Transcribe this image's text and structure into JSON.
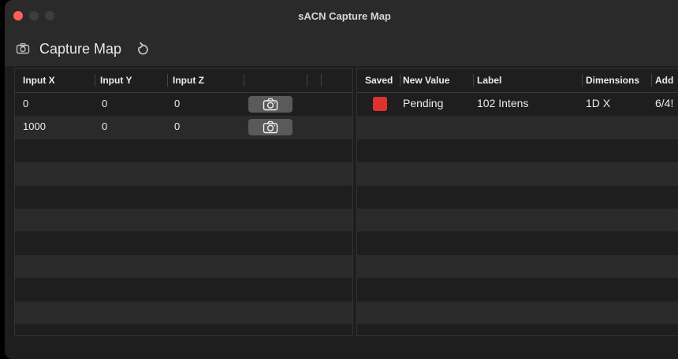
{
  "window": {
    "title": "sACN Capture Map"
  },
  "toolbar": {
    "title": "Capture Map"
  },
  "left_table": {
    "headers": [
      "Input X",
      "Input Y",
      "Input Z"
    ],
    "rows": [
      {
        "x": "0",
        "y": "0",
        "z": "0"
      },
      {
        "x": "1000",
        "y": "0",
        "z": "0"
      }
    ]
  },
  "right_table": {
    "headers": [
      "Saved",
      "New Value",
      "Label",
      "Dimensions",
      "Add"
    ],
    "rows": [
      {
        "saved_color": "#e03131",
        "new_value": "Pending",
        "label": "102 Intens",
        "dimensions": "1D X",
        "address": "6/4!"
      }
    ]
  }
}
